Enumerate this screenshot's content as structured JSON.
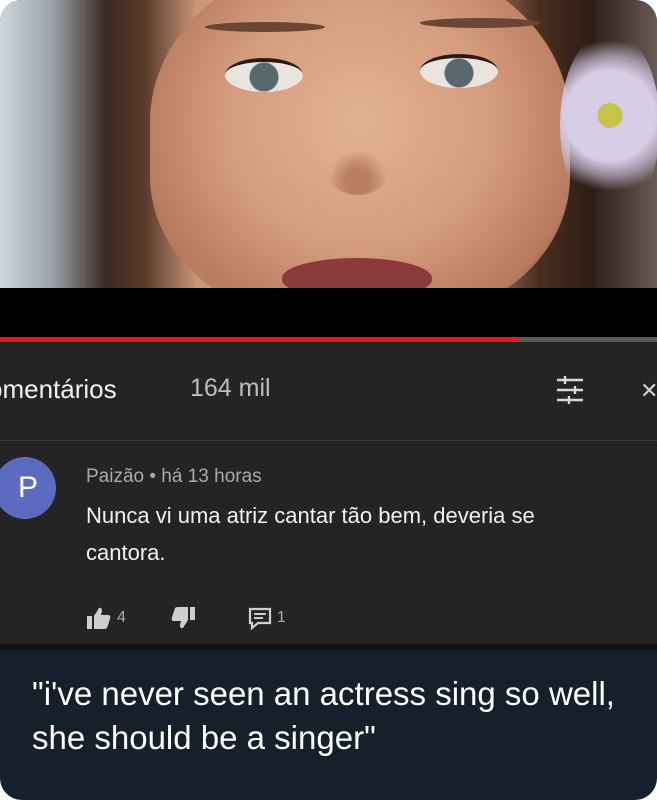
{
  "comments_header": {
    "title": "omentários",
    "count": "164 mil",
    "icons": [
      "sort-icon",
      "close-icon"
    ]
  },
  "video": {
    "progress_fraction": 0.79,
    "progress_color": "#e01b1b"
  },
  "comment": {
    "avatar_letter": "P",
    "avatar_color": "#5c6bc0",
    "meta": "Paizão • há 13 horas",
    "text": "Nunca vi uma atriz cantar tão bem, deveria se\ncantora.",
    "likes": "4",
    "replies": "1",
    "icons": [
      "thumbs-up-icon",
      "thumbs-down-icon",
      "reply-icon"
    ]
  },
  "caption": {
    "text": "\"i've never seen an actress sing so well, she should be a singer\""
  },
  "colors": {
    "background": "#15202b",
    "youtube_panel": "#242424"
  }
}
